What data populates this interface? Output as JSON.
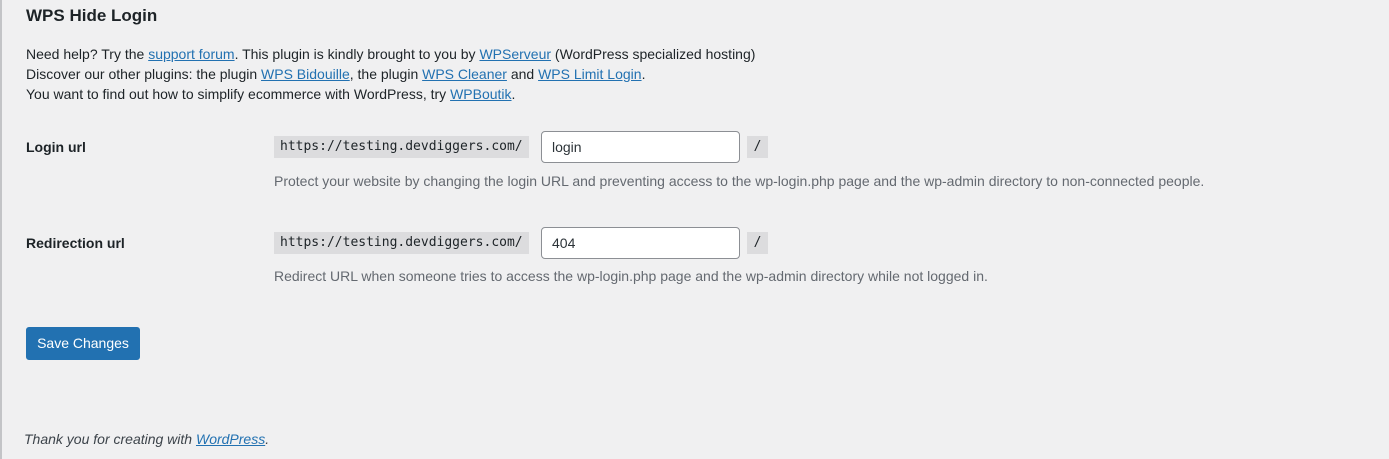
{
  "page": {
    "title": "WPS Hide Login"
  },
  "intro": {
    "line1_before": "Need help? Try the ",
    "line1_link1": "support forum",
    "line1_middle": ". This plugin is kindly brought to you by ",
    "line1_link2": "WPServeur",
    "line1_after": " (WordPress specialized hosting)",
    "line2_before": "Discover our other plugins: the plugin ",
    "line2_link1": "WPS Bidouille",
    "line2_sep1": ", the plugin ",
    "line2_link2": "WPS Cleaner",
    "line2_sep2": " and ",
    "line2_link3": "WPS Limit Login",
    "line2_after": ".",
    "line3_before": "You want to find out how to simplify ecommerce with WordPress, try ",
    "line3_link": "WPBoutik",
    "line3_after": "."
  },
  "login_url": {
    "label": "Login url",
    "prefix": "https://testing.devdiggers.com/",
    "value": "login",
    "suffix": "/",
    "description": "Protect your website by changing the login URL and preventing access to the wp-login.php page and the wp-admin directory to non-connected people."
  },
  "redirection_url": {
    "label": "Redirection url",
    "prefix": "https://testing.devdiggers.com/",
    "value": "404",
    "suffix": "/",
    "description": "Redirect URL when someone tries to access the wp-login.php page and the wp-admin directory while not logged in."
  },
  "actions": {
    "save_label": "Save Changes"
  },
  "footer": {
    "text_before": "Thank you for creating with ",
    "link": "WordPress",
    "text_after": "."
  },
  "colors": {
    "accent": "#2271b1",
    "background": "#f0f0f1",
    "muted_text": "#646970"
  }
}
